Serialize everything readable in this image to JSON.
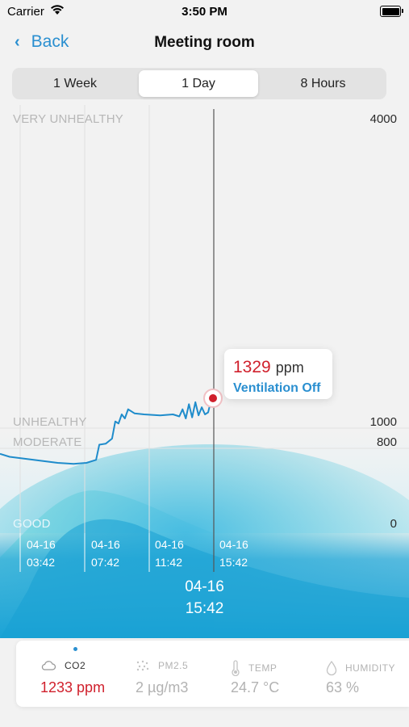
{
  "status_bar": {
    "carrier": "Carrier",
    "time": "3:50 PM"
  },
  "nav": {
    "back_label": "Back",
    "title": "Meeting room"
  },
  "range_tabs": [
    {
      "label": "1 Week",
      "selected": false
    },
    {
      "label": "1 Day",
      "selected": true
    },
    {
      "label": "8 Hours",
      "selected": false
    }
  ],
  "chart": {
    "levels": [
      "VERY UNHEALTHY",
      "UNHEALTHY",
      "MODERATE",
      "GOOD"
    ],
    "y_ticks": [
      "4000",
      "1000",
      "800",
      "0"
    ],
    "x_ticks": [
      {
        "date": "04-16",
        "time": "03:42"
      },
      {
        "date": "04-16",
        "time": "07:42"
      },
      {
        "date": "04-16",
        "time": "11:42"
      },
      {
        "date": "04-16",
        "time": "15:42"
      }
    ],
    "selected": {
      "date": "04-16",
      "time": "15:42"
    },
    "tooltip": {
      "value": "1329",
      "unit": "ppm",
      "status": "Ventilation Off"
    }
  },
  "chart_data": {
    "type": "line",
    "ylim": [
      0,
      4000
    ],
    "series": [
      {
        "values": [
          [
            0.0,
            690
          ],
          [
            0.3,
            660
          ],
          [
            0.8,
            640
          ],
          [
            1.3,
            620
          ],
          [
            1.8,
            600
          ],
          [
            2.3,
            590
          ],
          [
            2.7,
            600
          ],
          [
            3.0,
            630
          ],
          [
            3.1,
            780
          ],
          [
            3.3,
            790
          ],
          [
            3.5,
            840
          ],
          [
            3.6,
            1010
          ],
          [
            3.7,
            990
          ],
          [
            3.8,
            1080
          ],
          [
            3.9,
            1040
          ],
          [
            4.0,
            1130
          ],
          [
            4.2,
            1090
          ],
          [
            4.5,
            1080
          ],
          [
            5.0,
            1070
          ],
          [
            5.4,
            1080
          ],
          [
            5.6,
            1060
          ],
          [
            5.7,
            1130
          ],
          [
            5.8,
            1040
          ],
          [
            5.9,
            1180
          ],
          [
            6.0,
            1050
          ],
          [
            6.1,
            1200
          ],
          [
            6.2,
            1070
          ],
          [
            6.3,
            1150
          ],
          [
            6.4,
            1080
          ],
          [
            6.5,
            1100
          ],
          [
            6.6,
            1230
          ],
          [
            6.65,
            1329
          ]
        ]
      }
    ]
  },
  "metrics": [
    {
      "label": "CO2",
      "value": "1233 ppm",
      "icon": "cloud-icon",
      "active": true
    },
    {
      "label": "PM2.5",
      "value": "2 µg/m3",
      "icon": "particles-icon",
      "active": false
    },
    {
      "label": "TEMP",
      "value": "24.7 °C",
      "icon": "thermometer-icon",
      "active": false
    },
    {
      "label": "HUMIDITY",
      "value": "63 %",
      "icon": "droplet-icon",
      "active": false
    }
  ],
  "colors": {
    "accent": "#2a8fd0",
    "alert": "#d0202c",
    "line": "#1f8ccb"
  }
}
